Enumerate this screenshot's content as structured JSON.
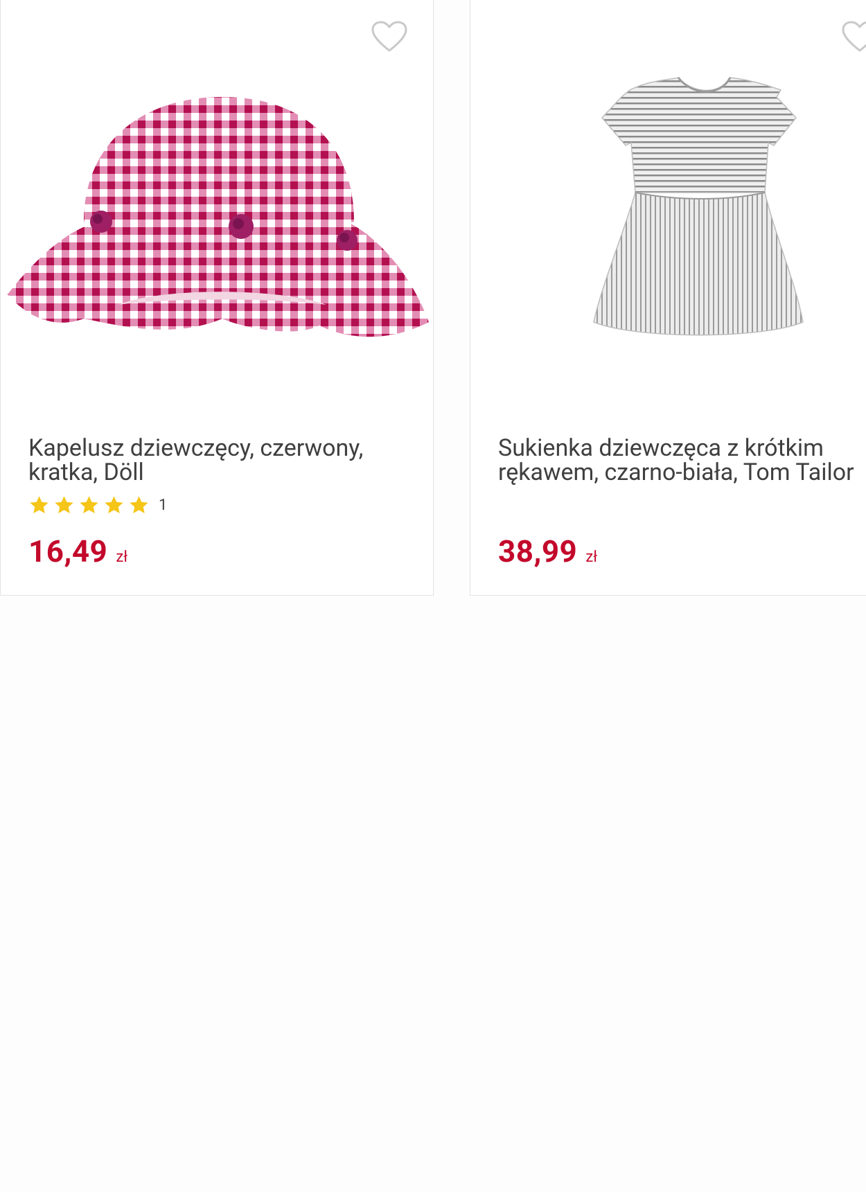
{
  "products": [
    {
      "title": "Kapelusz dziewczęcy, czerwony, kratka, Döll",
      "rating": {
        "stars": 5,
        "max": 5,
        "count": "1"
      },
      "price": "16,49",
      "currency": "zł",
      "image_icon": "gingham-hat-image"
    },
    {
      "title": "Sukienka dziewczęca z krótkim rękawem, czarno-biała, Tom Tailor",
      "price": "38,99",
      "currency": "zł",
      "image_icon": "striped-dress-image"
    }
  ],
  "colors": {
    "price": "#c3092b",
    "star": "#f5c518",
    "hat_check": "#c8175a",
    "heart_outline": "#c9c9c9",
    "card_border": "#e3e3e3"
  }
}
